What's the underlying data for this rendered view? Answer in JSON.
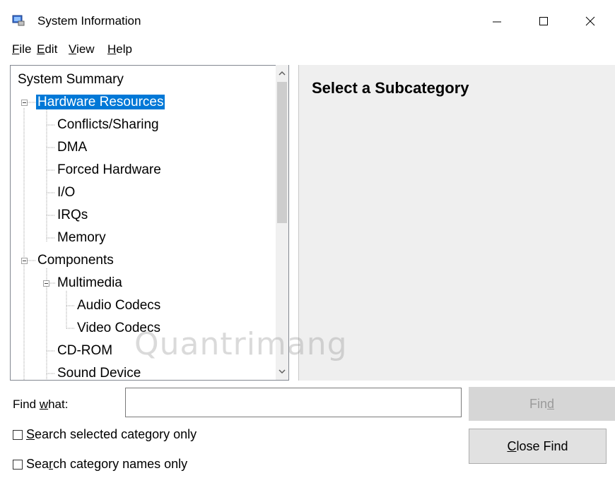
{
  "window": {
    "title": "System Information",
    "icon": "system-info-icon"
  },
  "menu": [
    {
      "label": "File",
      "key": "F",
      "rest": "ile"
    },
    {
      "label": "Edit",
      "key": "E",
      "rest": "dit"
    },
    {
      "label": "View",
      "key": "V",
      "rest": "iew"
    },
    {
      "label": "Help",
      "key": "H",
      "rest": "elp"
    }
  ],
  "tree": {
    "items": [
      {
        "label": "System Summary",
        "level": 0,
        "expander": false,
        "selected": false
      },
      {
        "label": "Hardware Resources",
        "level": 1,
        "expander": true,
        "selected": true
      },
      {
        "label": "Conflicts/Sharing",
        "level": 2,
        "expander": false,
        "selected": false
      },
      {
        "label": "DMA",
        "level": 2,
        "expander": false,
        "selected": false
      },
      {
        "label": "Forced Hardware",
        "level": 2,
        "expander": false,
        "selected": false
      },
      {
        "label": "I/O",
        "level": 2,
        "expander": false,
        "selected": false
      },
      {
        "label": "IRQs",
        "level": 2,
        "expander": false,
        "selected": false
      },
      {
        "label": "Memory",
        "level": 2,
        "expander": false,
        "selected": false
      },
      {
        "label": "Components",
        "level": 1,
        "expander": true,
        "selected": false
      },
      {
        "label": "Multimedia",
        "level": 2,
        "expander": true,
        "selected": false
      },
      {
        "label": "Audio Codecs",
        "level": 3,
        "expander": false,
        "selected": false
      },
      {
        "label": "Video Codecs",
        "level": 3,
        "expander": false,
        "selected": false
      },
      {
        "label": "CD-ROM",
        "level": 2,
        "expander": false,
        "selected": false
      },
      {
        "label": "Sound Device",
        "level": 2,
        "expander": false,
        "selected": false
      }
    ]
  },
  "detail": {
    "heading": "Select a Subcategory"
  },
  "find": {
    "label_pre": "Find ",
    "label_key": "w",
    "label_post": "hat:",
    "value": "",
    "find_button_pre": "Fin",
    "find_button_key": "d",
    "close_button_key": "C",
    "close_button_post": "lose Find"
  },
  "options": {
    "search_selected_key": "S",
    "search_selected_rest": "earch selected category only",
    "search_names_pre": "Sea",
    "search_names_key": "r",
    "search_names_post": "ch category names only"
  },
  "watermark": "Quantrimang"
}
